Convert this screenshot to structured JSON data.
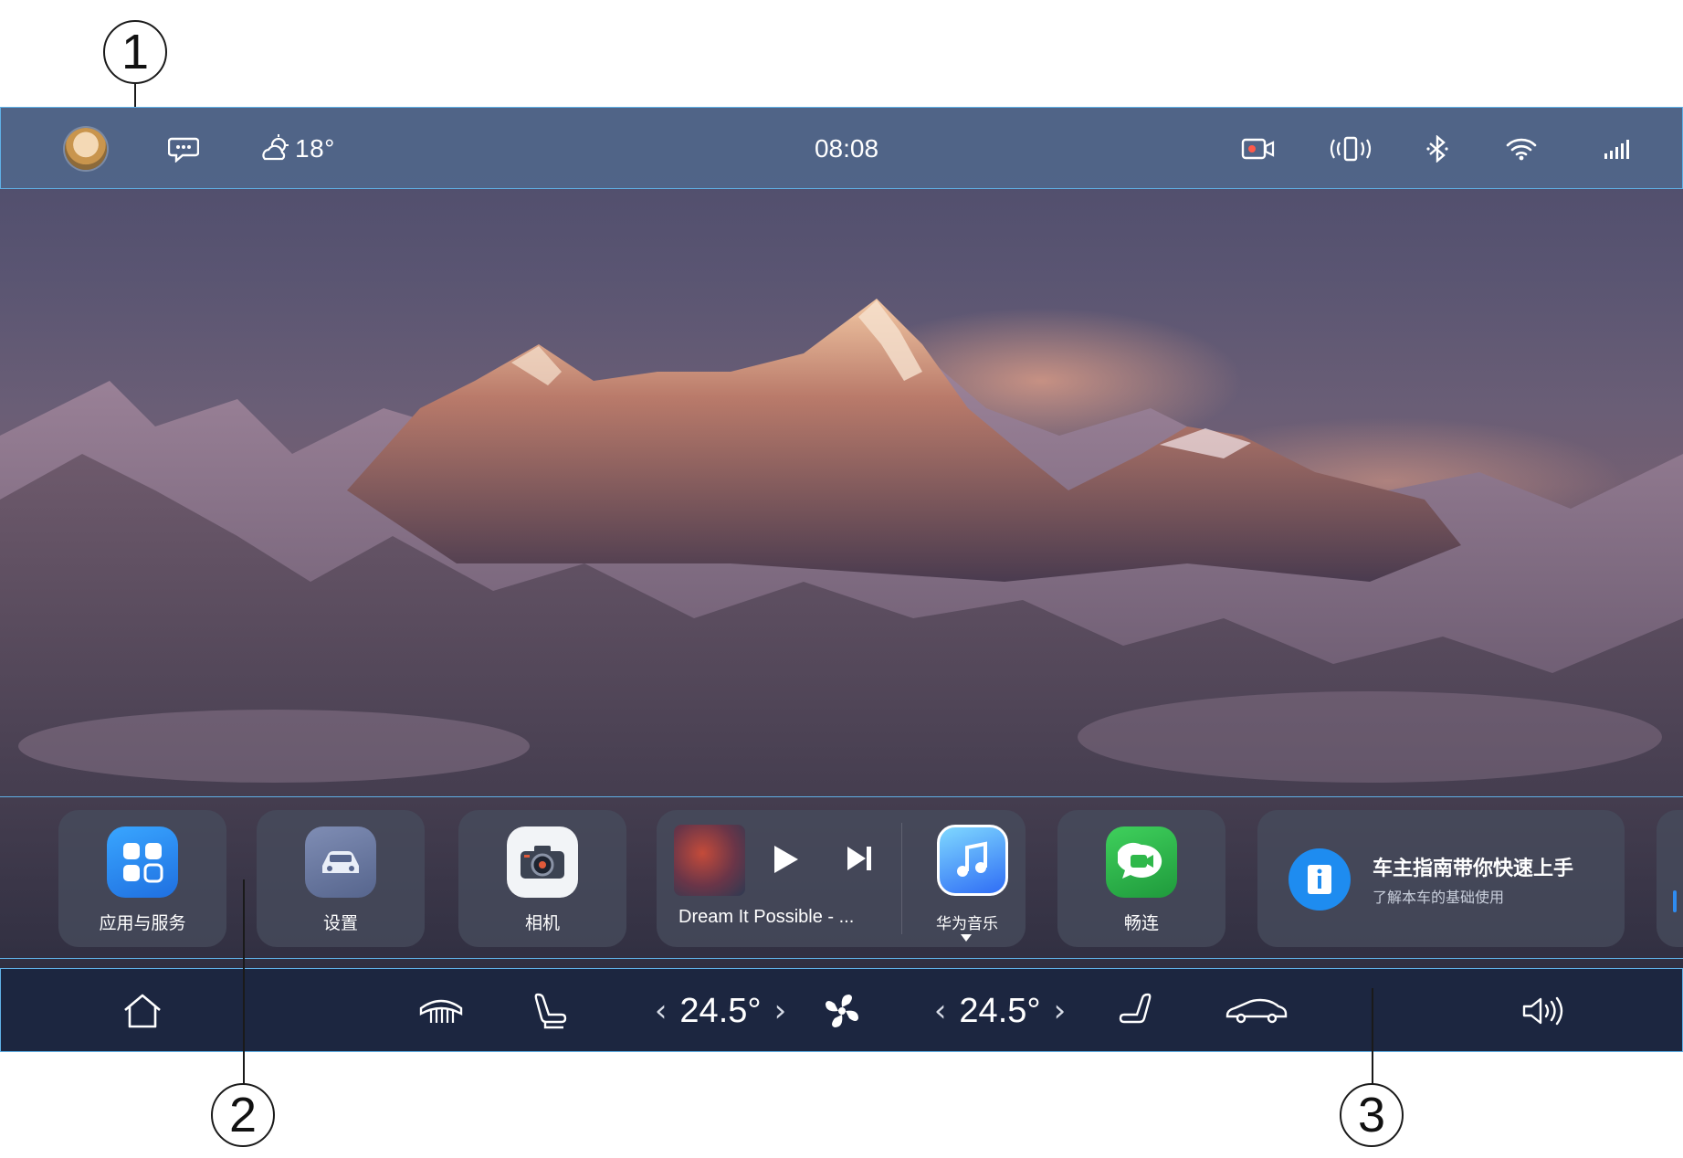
{
  "callouts": {
    "one": "1",
    "two": "2",
    "three": "3"
  },
  "status_bar": {
    "avatar_icon": "user-avatar",
    "message_icon": "chat-bubble-icon",
    "weather": {
      "icon": "partly-cloudy-icon",
      "temperature": "18°"
    },
    "time": "08:08",
    "right_icons": [
      "dashcam-icon",
      "vibrate-icon",
      "bluetooth-icon",
      "wifi-icon",
      "signal-icon"
    ]
  },
  "dock": {
    "apps": [
      {
        "label": "应用与服务",
        "icon": "apps-grid-icon"
      },
      {
        "label": "设置",
        "icon": "car-settings-icon"
      },
      {
        "label": "相机",
        "icon": "camera-icon"
      }
    ],
    "music": {
      "track": "Dream It Possible - ...",
      "app_label": "华为音乐",
      "play_icon": "play-icon",
      "next_icon": "next-track-icon",
      "app_icon": "music-note-icon"
    },
    "meetime": {
      "label": "畅连",
      "icon": "video-chat-icon"
    },
    "guide": {
      "title": "车主指南带你快速上手",
      "subtitle": "了解本车的基础使用",
      "icon": "info-book-icon"
    }
  },
  "control_bar": {
    "home_icon": "home-icon",
    "defrost_icon": "rear-defrost-icon",
    "left_seat_icon": "driver-seat-icon",
    "left_temp": "24.5°",
    "fan_icon": "fan-icon",
    "right_temp": "24.5°",
    "right_seat_icon": "passenger-seat-icon",
    "car_icon": "car-icon",
    "volume_icon": "volume-icon",
    "chevron_left": "‹",
    "chevron_right": "›"
  },
  "colors": {
    "status_bar_bg": "#50668a",
    "control_bar_bg": "#1c2640",
    "outline_accent": "#5fb0e6",
    "apps_icon_blue": "#2f8cf0",
    "meetime_green": "#2fb84a",
    "guide_icon_blue": "#1e8cf0"
  }
}
